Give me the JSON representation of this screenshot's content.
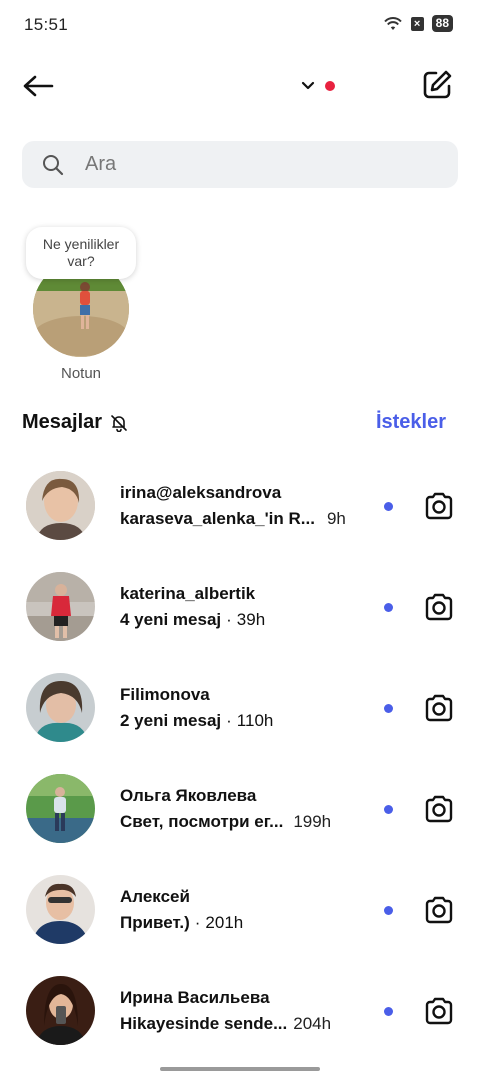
{
  "status_bar": {
    "time": "15:51",
    "battery": "88"
  },
  "header": {
    "unread_indicator_color": "#e8213f"
  },
  "search": {
    "placeholder": "Ara"
  },
  "notes": {
    "bubble_text": "Ne yenilikler var?",
    "own_label": "Notun"
  },
  "section": {
    "title": "Mesajlar",
    "requests_label": "İstekler"
  },
  "threads": [
    {
      "name": "irina@aleksandrova",
      "message": "karaseva_alenka_'in R...",
      "time": "9h",
      "bold": true
    },
    {
      "name": "katerina_albertik",
      "message": "4 yeni mesaj",
      "time": "39h",
      "bold": true
    },
    {
      "name": "Filimonova",
      "message": "2 yeni mesaj",
      "time": "110h",
      "bold": true
    },
    {
      "name": "Ольга Яковлева",
      "message": "Свет, посмотри ег...",
      "time": "199h",
      "bold": true
    },
    {
      "name": "Алексей",
      "message": "Привет.)",
      "time": "201h",
      "bold": true
    },
    {
      "name": "Ирина Васильева",
      "message": "Hikayesinde sende...",
      "time": "204h",
      "bold": true
    }
  ],
  "colors": {
    "accent": "#4a5ee8",
    "unread_dot": "#4a5ee8"
  }
}
